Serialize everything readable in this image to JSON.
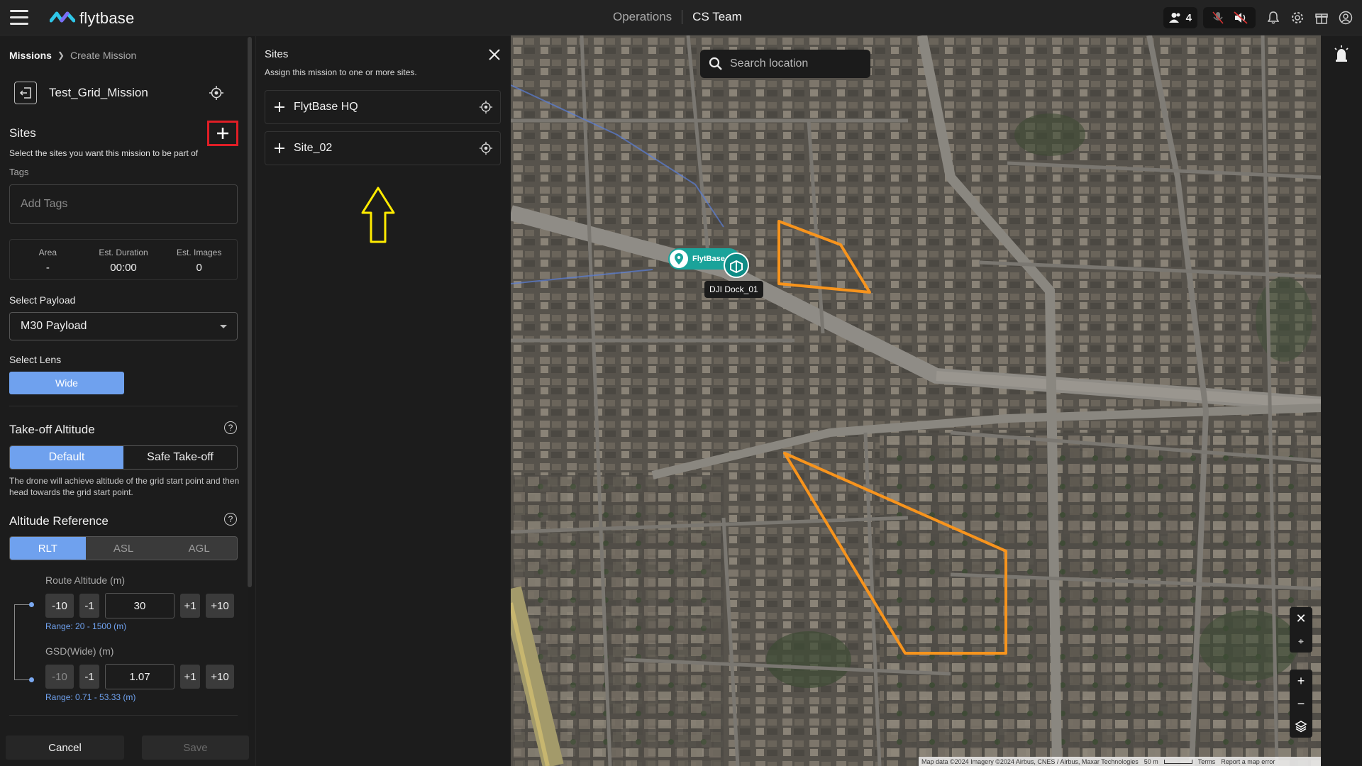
{
  "topbar": {
    "brand": "flytbase",
    "nav_operations": "Operations",
    "nav_team": "CS Team",
    "users_count": "4"
  },
  "mission": {
    "breadcrumb_root": "Missions",
    "breadcrumb_current": "Create Mission",
    "name": "Test_Grid_Mission",
    "sites_title": "Sites",
    "sites_desc": "Select the sites you want this mission to be part of",
    "tags_label": "Tags",
    "tags_placeholder": "Add Tags",
    "stats": [
      {
        "label": "Area",
        "value": "-"
      },
      {
        "label": "Est. Duration",
        "value": "00:00"
      },
      {
        "label": "Est. Images",
        "value": "0"
      }
    ],
    "payload_label": "Select Payload",
    "payload_value": "M30 Payload",
    "lens_label": "Select Lens",
    "lens_value": "Wide",
    "takeoff_title": "Take-off Altitude",
    "takeoff_options": [
      "Default",
      "Safe Take-off"
    ],
    "takeoff_note": "The drone will achieve altitude of the grid start point and then head towards the grid start point.",
    "altref_title": "Altitude Reference",
    "altref_options": [
      "RLT",
      "ASL",
      "AGL"
    ],
    "route_alt_label": "Route Altitude (m)",
    "route_alt_value": "30",
    "route_alt_range": "Range: 20 - 1500 (m)",
    "gsd_label": "GSD(Wide) (m)",
    "gsd_value": "1.07",
    "gsd_range": "Range: 0.71 - 53.33 (m)",
    "step_buttons": [
      "-10",
      "-1",
      "+1",
      "+10"
    ],
    "cancel": "Cancel",
    "save": "Save"
  },
  "drawer": {
    "title": "Sites",
    "desc": "Assign this mission to one or more sites.",
    "sites": [
      "FlytBase HQ",
      "Site_02"
    ]
  },
  "map": {
    "search_placeholder": "Search location",
    "site_marker": "FlytBase...",
    "dock_label": "DJI Dock_01",
    "attribution": "Map data ©2024 Imagery ©2024 Airbus, CNES / Airbus, Maxar Technologies",
    "scale": "50 m",
    "terms": "Terms",
    "report": "Report a map error"
  },
  "colors": {
    "accent": "#6fa1ee",
    "highlight_red": "#e01e26",
    "polygon_orange": "#f7941d",
    "arrow_yellow": "#ffeb00",
    "teal": "#1aa39a"
  }
}
